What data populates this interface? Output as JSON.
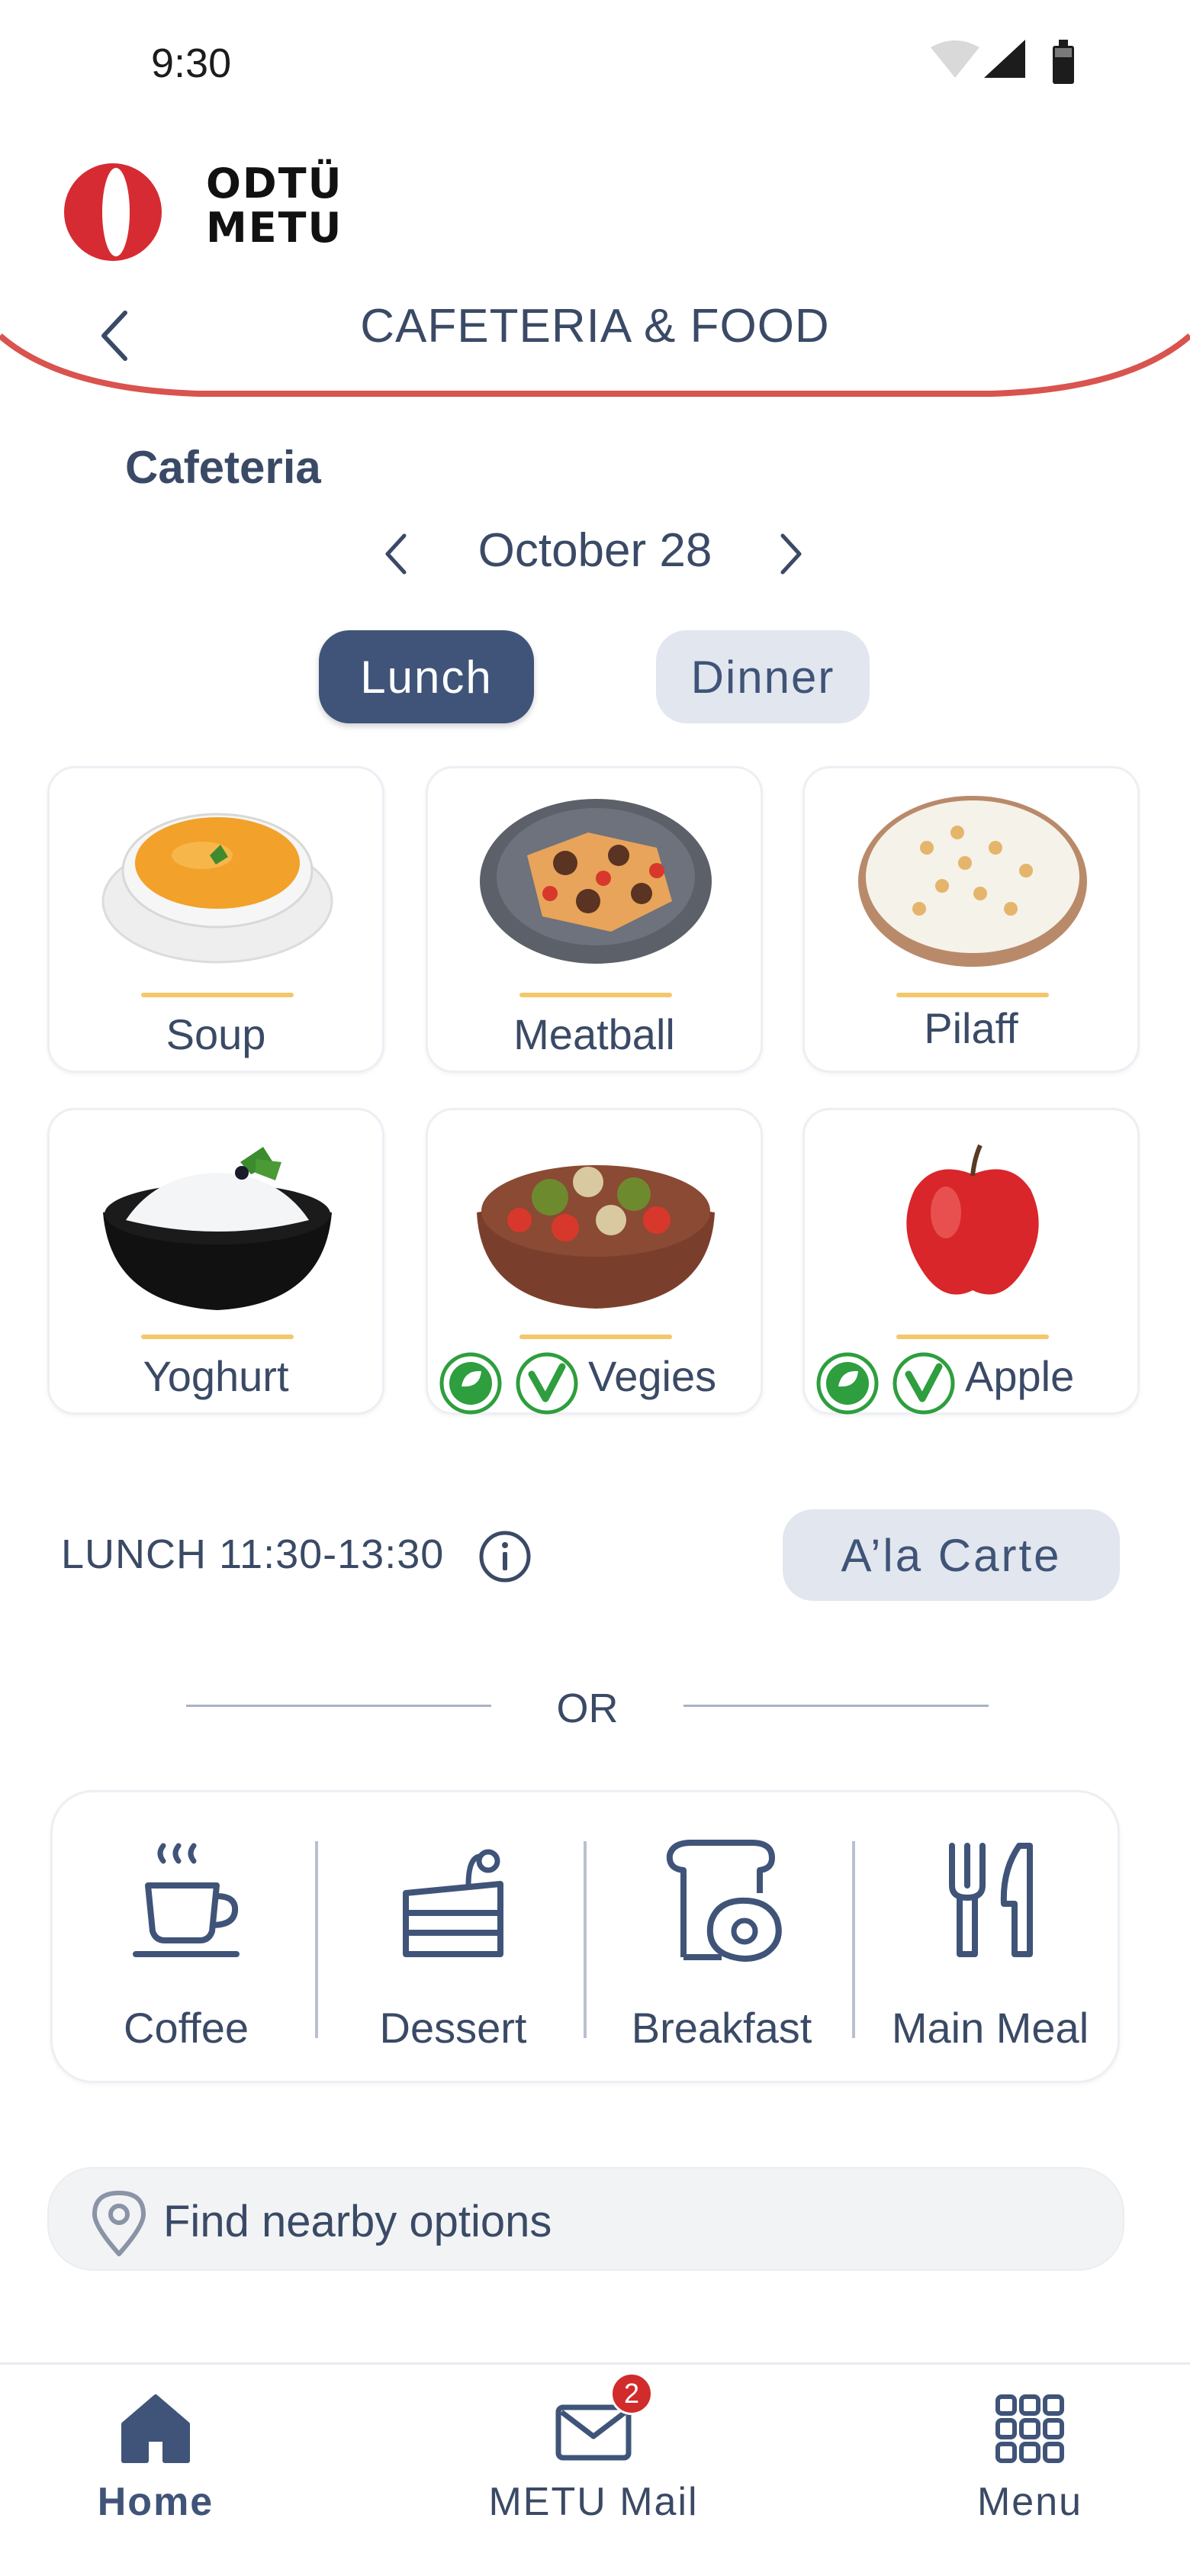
{
  "status_bar": {
    "time": "9:30"
  },
  "header": {
    "logo_text_line1": "ODTÜ",
    "logo_text_line2": "METU",
    "title": "CAFETERIA & FOOD",
    "accent_color": "#d9534f"
  },
  "section": {
    "title": "Cafeteria"
  },
  "date": {
    "label": "October 28"
  },
  "meal_tabs": {
    "lunch": "Lunch",
    "dinner": "Dinner",
    "selected": "Lunch"
  },
  "foods": [
    {
      "name": "Soup",
      "badges": []
    },
    {
      "name": "Meatball",
      "badges": []
    },
    {
      "name": "Pilaff",
      "badges": []
    },
    {
      "name": "Yoghurt",
      "badges": []
    },
    {
      "name": "Vegies",
      "badges": [
        "vegan",
        "vegetarian"
      ]
    },
    {
      "name": "Apple",
      "badges": [
        "vegan",
        "vegetarian"
      ]
    }
  ],
  "service": {
    "hours": "LUNCH 11:30-13:30",
    "alacarte_label": "A’la Carte"
  },
  "separator": {
    "text": "OR"
  },
  "categories": [
    {
      "label": "Coffee",
      "icon": "coffee-cup-icon"
    },
    {
      "label": "Dessert",
      "icon": "cake-icon"
    },
    {
      "label": "Breakfast",
      "icon": "toast-egg-icon"
    },
    {
      "label": "Main Meal",
      "icon": "fork-knife-icon"
    }
  ],
  "nearby": {
    "text": "Find nearby options"
  },
  "bottom_nav": {
    "home": "Home",
    "mail": "METU Mail",
    "mail_badge": "2",
    "menu": "Menu",
    "active": "Home"
  },
  "colors": {
    "primary": "#3f5478",
    "pill_bg": "#e2e6ee",
    "underline": "#f4c76a",
    "badge_green": "#2e9e3e"
  }
}
